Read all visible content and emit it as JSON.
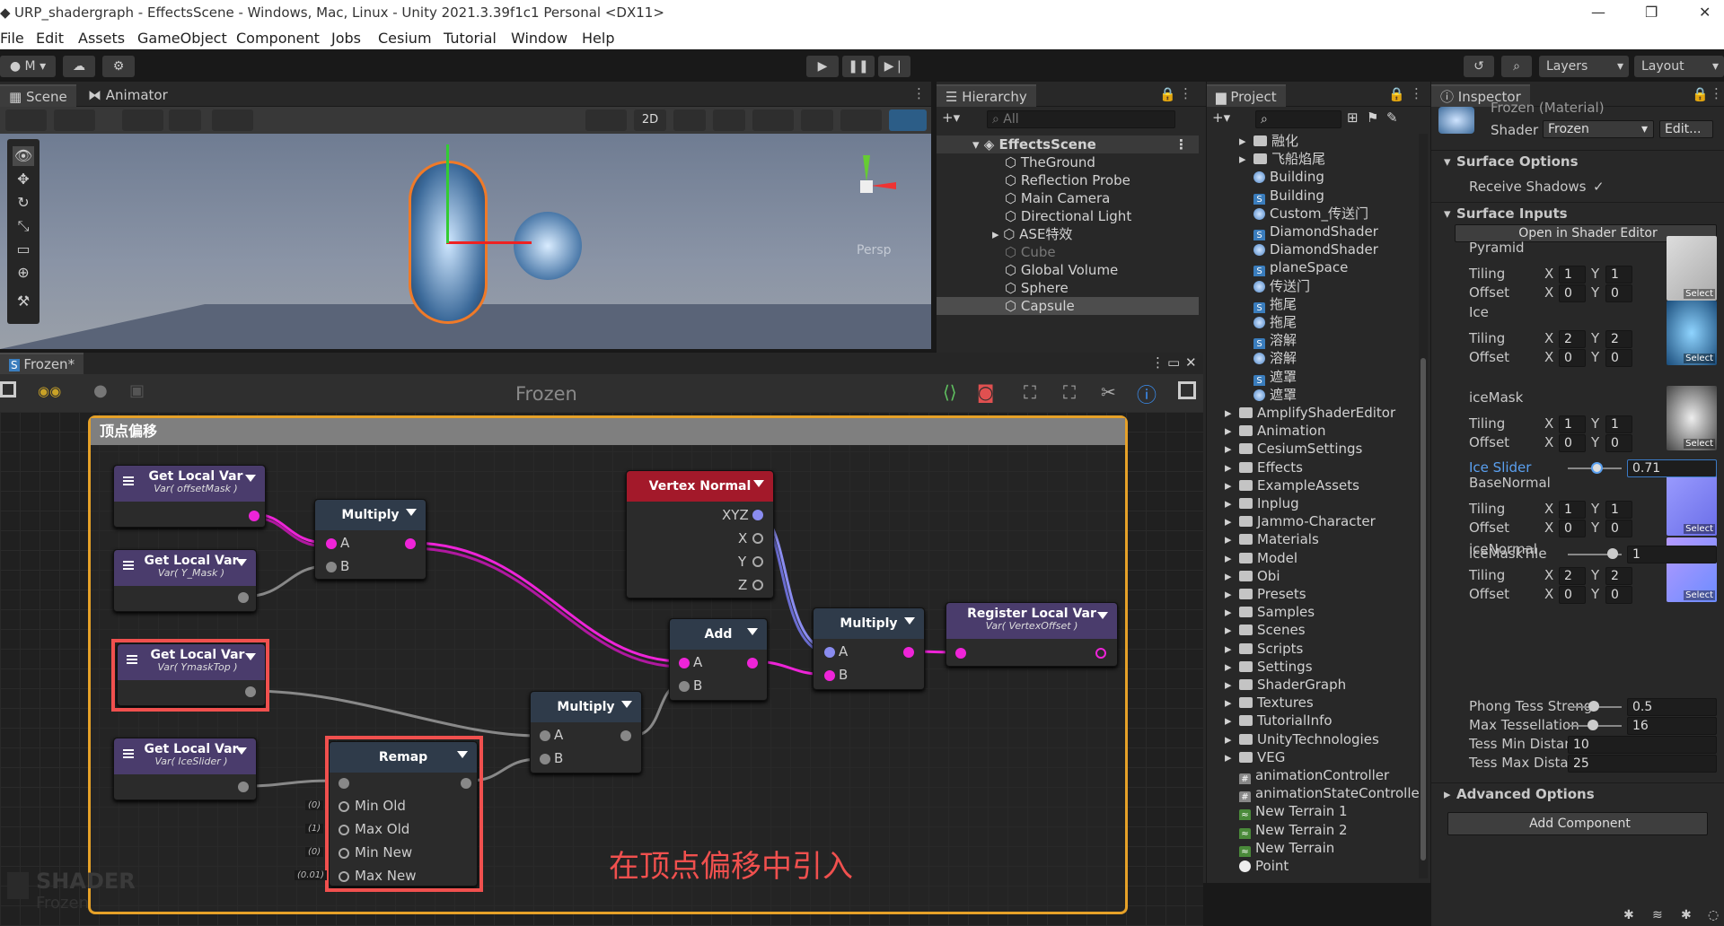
{
  "window": {
    "title": "URP_shadergraph - EffectsScene - Windows, Mac, Linux - Unity 2021.3.39f1c1 Personal <DX11>"
  },
  "menu": [
    "File",
    "Edit",
    "Assets",
    "GameObject",
    "Component",
    "Jobs",
    "Cesium",
    "Tutorial",
    "Window",
    "Help"
  ],
  "toolbar": {
    "account": "M",
    "layers": "Layers",
    "layout": "Layout"
  },
  "scene": {
    "tab_scene": "Scene",
    "tab_animator": "Animator",
    "mode_2d": "2D",
    "persp": "Persp"
  },
  "hierarchy": {
    "title": "Hierarchy",
    "search": "All",
    "scene": "EffectsScene",
    "items": [
      "TheGround",
      "Reflection Probe",
      "Main Camera",
      "Directional Light",
      "ASE特效",
      "Cube",
      "Global Volume",
      "Sphere",
      "Capsule"
    ]
  },
  "project": {
    "title": "Project",
    "items": [
      "融化",
      "飞船焰尾",
      "Building",
      "Building",
      "Custom_传送门",
      "DiamondShader",
      "DiamondShader",
      "planeSpace",
      "传送门",
      "拖尾",
      "拖尾",
      "溶解",
      "溶解",
      "遮罩",
      "遮罩",
      "AmplifyShaderEditor",
      "Animation",
      "CesiumSettings",
      "Effects",
      "ExampleAssets",
      "Inplug",
      "Jammo-Character",
      "Materials",
      "Model",
      "Obi",
      "Presets",
      "Samples",
      "Scenes",
      "Scripts",
      "Settings",
      "ShaderGraph",
      "Textures",
      "TutorialInfo",
      "UnityTechnologies",
      "VEG",
      "animationController",
      "animationStateControlle",
      "New Terrain 1",
      "New Terrain 2",
      "New Terrain",
      "Point"
    ]
  },
  "inspector": {
    "title": "Inspector",
    "material": "Frozen (Material)",
    "shader_label": "Shader",
    "shader": "Frozen",
    "edit": "Edit...",
    "surface_options": "Surface Options",
    "receive_shadows": "Receive Shadows",
    "receive_check": "✓",
    "surface_inputs": "Surface Inputs",
    "open_editor": "Open in Shader Editor",
    "tiling": "Tiling",
    "offset": "Offset",
    "x": "X",
    "y": "Y",
    "select": "Select",
    "pyramid": "Pyramid",
    "pyr_tx": "1",
    "pyr_ty": "1",
    "pyr_ox": "0",
    "pyr_oy": "0",
    "ice": "Ice",
    "ice_tx": "2",
    "ice_ty": "2",
    "ice_ox": "0",
    "ice_oy": "0",
    "ice_slider": "Ice Slider",
    "ice_slider_val": "0.71",
    "icemask": "iceMask",
    "mask_tx": "1",
    "mask_ty": "1",
    "mask_ox": "0",
    "mask_oy": "0",
    "icemasktile": "iceMaskTile",
    "icemasktile_val": "1",
    "basenormal": "BaseNormal",
    "bn_tx": "1",
    "bn_ty": "1",
    "bn_ox": "0",
    "bn_oy": "0",
    "icenormal": "iceNormal",
    "in_tx": "2",
    "in_ty": "2",
    "in_ox": "0",
    "in_oy": "0",
    "phong": "Phong Tess Streng",
    "phong_val": "0.5",
    "maxtess": "Max Tessellation",
    "maxtess_val": "16",
    "tessmin": "Tess Min Distance",
    "tessmin_val": "10",
    "tessmax": "Tess Max Distanc",
    "tessmax_val": "25",
    "advanced": "Advanced Options",
    "add_component": "Add Component"
  },
  "graph": {
    "tab": "Frozen*",
    "title": "Frozen",
    "group": "顶点偏移",
    "annotation": "在顶点偏移中引入",
    "watermark": "SHADER",
    "watermark2": "Frozen",
    "n_get1": "Get Local Var",
    "n_get1_sub": "Var( offsetMask )",
    "n_get2": "Get Local Var",
    "n_get2_sub": "Var( Y_Mask )",
    "n_get3": "Get Local Var",
    "n_get3_sub": "Var( YmaskTop )",
    "n_get4": "Get Local Var",
    "n_get4_sub": "Var( IceSlider )",
    "n_mul1": "Multiply",
    "n_mul2": "Multiply",
    "n_mul3": "Multiply",
    "n_vn": "Vertex Normal",
    "n_add": "Add",
    "n_remap": "Remap",
    "n_reg": "Register Local Var",
    "n_reg_sub": "Var( VertexOffset )",
    "a": "A",
    "b": "B",
    "xyz": "XYZ",
    "px": "X",
    "py": "Y",
    "pz": "Z",
    "min_old": "Min Old",
    "max_old": "Max Old",
    "min_new": "Min New",
    "max_new": "Max New",
    "d0": "(0)",
    "d1": "(1)",
    "d2": "(0)",
    "d3": "(0.01)"
  },
  "colors": {
    "accent": "#e6a128",
    "highlight": "#f0504e",
    "pin": "#ee24d8",
    "vn_header": "#a3192a",
    "node_header": "#2f3b4a",
    "get_header": "#4a3c6c"
  }
}
